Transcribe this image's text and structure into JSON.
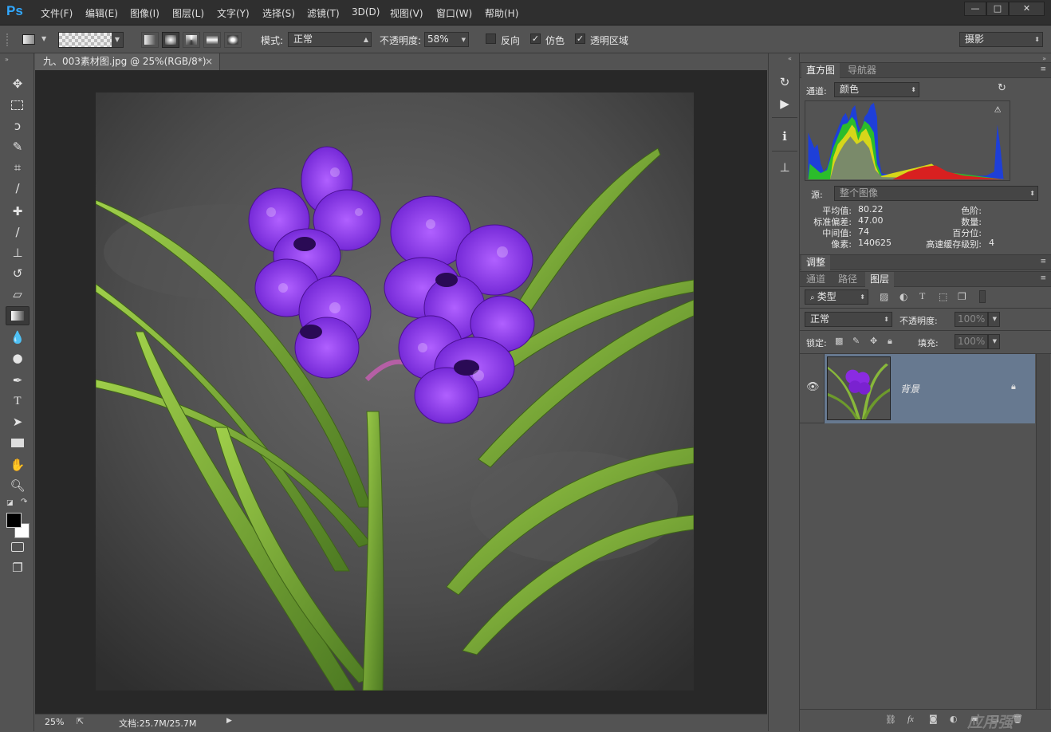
{
  "app": {
    "logo": "Ps",
    "menu": [
      "文件(F)",
      "编辑(E)",
      "图像(I)",
      "图层(L)",
      "文字(Y)",
      "选择(S)",
      "滤镜(T)",
      "3D(D)",
      "视图(V)",
      "窗口(W)",
      "帮助(H)"
    ],
    "window_controls": [
      "—",
      "□",
      "✕"
    ]
  },
  "options": {
    "mode_label": "模式:",
    "mode_value": "正常",
    "opacity_label": "不透明度:",
    "opacity_value": "58%",
    "reverse_label": "反向",
    "dither_label": "仿色",
    "transparency_label": "透明区域",
    "reverse_checked": false,
    "dither_checked": true,
    "transparency_checked": true,
    "workspace": "摄影"
  },
  "document": {
    "tab_title": "九、003素材图.jpg @ 25%(RGB/8*)",
    "zoom": "25%",
    "doc_size": "文档:25.7M/25.7M"
  },
  "histogram_panel": {
    "tabs": [
      "直方图",
      "导航器"
    ],
    "channel_label": "通道:",
    "channel_value": "颜色",
    "source_label": "源:",
    "source_value": "整个图像",
    "stats_left": [
      {
        "label": "平均值:",
        "value": "80.22"
      },
      {
        "label": "标准偏差:",
        "value": "47.00"
      },
      {
        "label": "中间值:",
        "value": "74"
      },
      {
        "label": "像素:",
        "value": "140625"
      }
    ],
    "stats_right": [
      {
        "label": "色阶:",
        "value": ""
      },
      {
        "label": "数量:",
        "value": ""
      },
      {
        "label": "百分位:",
        "value": ""
      },
      {
        "label": "高速缓存级别:",
        "value": "4"
      }
    ]
  },
  "adjustments_panel": {
    "tab": "调整"
  },
  "layers_panel": {
    "tabs": [
      "通道",
      "路径",
      "图层"
    ],
    "filter_value": "类型",
    "blend_mode": "正常",
    "opacity_label": "不透明度:",
    "opacity_value": "100%",
    "lock_label": "锁定:",
    "fill_label": "填充:",
    "fill_value": "100%",
    "layers": [
      {
        "name": "背景",
        "visible": true,
        "locked": true
      }
    ]
  },
  "watermark": "应用强",
  "colors": {
    "selected_layer": "#677990",
    "flower": "#8a2be2",
    "leaf": "#7aa535"
  }
}
